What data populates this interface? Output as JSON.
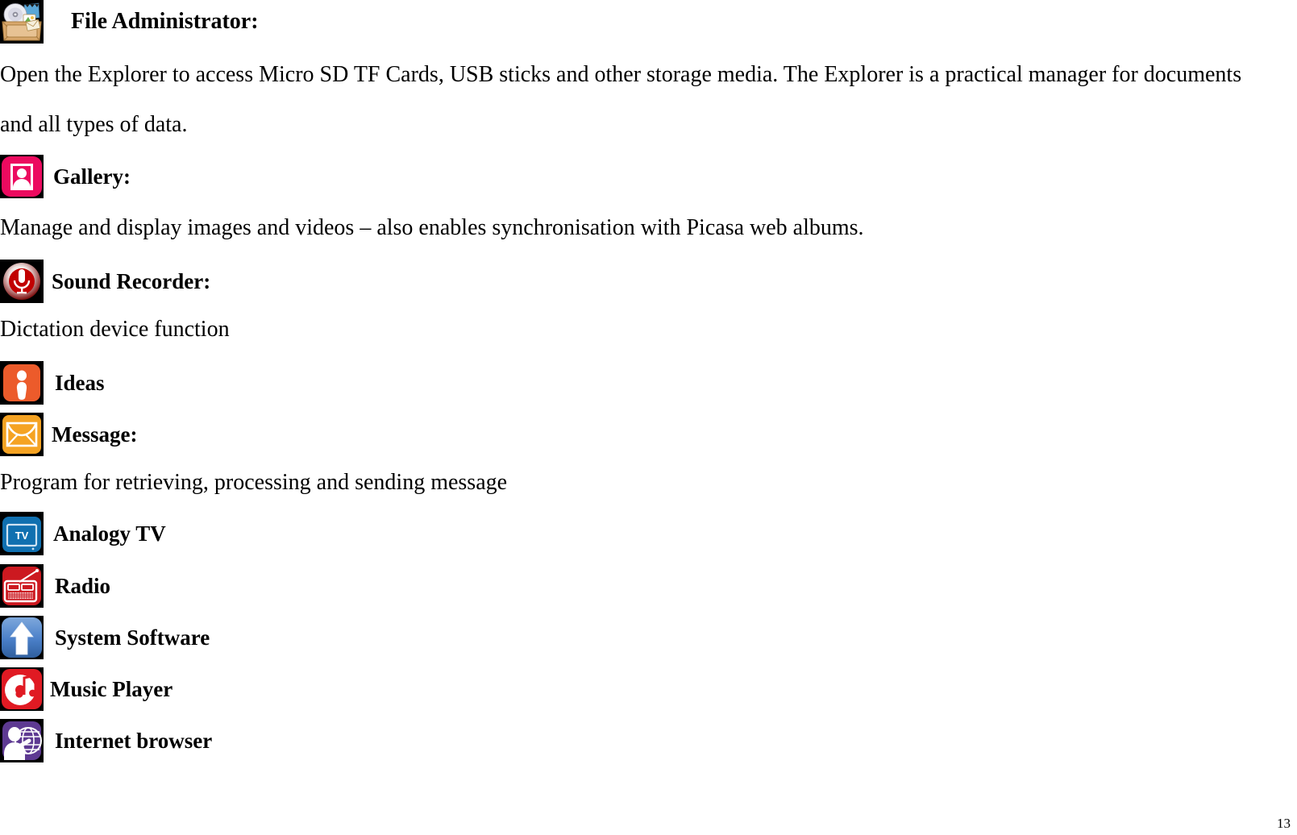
{
  "document": {
    "page_number": "13",
    "type": "user-manual-page"
  },
  "entries": [
    {
      "icon": "file-manager-icon",
      "icon_colors": {
        "background": "#000000",
        "box": "#d9a86c",
        "disc": "#e8e8ec"
      },
      "label": "File Administrator:",
      "description_lines": [
        "Open the Explorer to access Micro SD TF Cards, USB sticks and other storage media. The Explorer is a practical manager for documents",
        "and all types of data."
      ]
    },
    {
      "icon": "gallery-icon",
      "icon_colors": {
        "background": "#000000",
        "tile": "#ec0a5f",
        "mark": "#ffffff"
      },
      "label": "Gallery:",
      "description_lines": [
        "Manage and display images and videos – also enables synchronisation with Picasa web albums."
      ]
    },
    {
      "icon": "sound-recorder-icon",
      "icon_colors": {
        "background": "#000000",
        "circle": "#c10000",
        "mark": "#ffffff"
      },
      "label": "Sound Recorder:",
      "description_lines": [
        "Dictation device function"
      ]
    },
    {
      "icon": "ideas-icon",
      "icon_colors": {
        "background": "#000000",
        "tile": "#ec5b2b",
        "mark": "#ffffff"
      },
      "label": "Ideas",
      "description_lines": []
    },
    {
      "icon": "message-envelope-icon",
      "icon_colors": {
        "background": "#000000",
        "tile": "#f5a323",
        "mark": "#ffffff"
      },
      "label": "Message:",
      "description_lines": [
        "Program for retrieving, processing and sending message"
      ]
    },
    {
      "icon": "analog-tv-icon",
      "icon_colors": {
        "background": "#000000",
        "tile": "#1070b0",
        "mark": "#ffffff"
      },
      "label": "Analogy TV",
      "icon_text": "TV",
      "description_lines": []
    },
    {
      "icon": "radio-icon",
      "icon_colors": {
        "background": "#000000",
        "tile": "#cc1920",
        "mark": "#ffffff"
      },
      "label": "Radio",
      "description_lines": []
    },
    {
      "icon": "system-software-arrow-icon",
      "icon_colors": {
        "background": "#000000",
        "tile": "#4a7fc8",
        "mark": "#ffffff"
      },
      "label": "System Software",
      "description_lines": []
    },
    {
      "icon": "music-player-icon",
      "icon_colors": {
        "background": "#000000",
        "tile": "#e01a23",
        "mark": "#ffffff"
      },
      "label": "Music Player",
      "description_lines": []
    },
    {
      "icon": "internet-browser-icon",
      "icon_colors": {
        "background": "#000000",
        "tile": "#5e3a92",
        "mark": "#ffffff"
      },
      "label": "Internet browser",
      "description_lines": []
    }
  ]
}
